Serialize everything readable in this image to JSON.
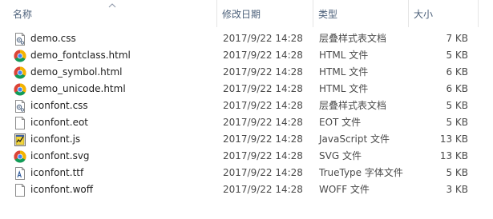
{
  "columns": {
    "name": "名称",
    "date": "修改日期",
    "type": "类型",
    "size": "大小"
  },
  "files": [
    {
      "name": "demo.css",
      "date": "2017/9/22 14:28",
      "type": "层叠样式表文档",
      "size": "7 KB",
      "icon": "css-file-icon"
    },
    {
      "name": "demo_fontclass.html",
      "date": "2017/9/22 14:28",
      "type": "HTML 文件",
      "size": "5 KB",
      "icon": "chrome-icon"
    },
    {
      "name": "demo_symbol.html",
      "date": "2017/9/22 14:28",
      "type": "HTML 文件",
      "size": "6 KB",
      "icon": "chrome-icon"
    },
    {
      "name": "demo_unicode.html",
      "date": "2017/9/22 14:28",
      "type": "HTML 文件",
      "size": "6 KB",
      "icon": "chrome-icon"
    },
    {
      "name": "iconfont.css",
      "date": "2017/9/22 14:28",
      "type": "层叠样式表文档",
      "size": "5 KB",
      "icon": "css-file-icon"
    },
    {
      "name": "iconfont.eot",
      "date": "2017/9/22 14:28",
      "type": "EOT 文件",
      "size": "5 KB",
      "icon": "blank-file-icon"
    },
    {
      "name": "iconfont.js",
      "date": "2017/9/22 14:28",
      "type": "JavaScript 文件",
      "size": "13 KB",
      "icon": "js-file-icon"
    },
    {
      "name": "iconfont.svg",
      "date": "2017/9/22 14:28",
      "type": "SVG 文件",
      "size": "13 KB",
      "icon": "chrome-icon"
    },
    {
      "name": "iconfont.ttf",
      "date": "2017/9/22 14:28",
      "type": "TrueType 字体文件",
      "size": "5 KB",
      "icon": "font-file-icon"
    },
    {
      "name": "iconfont.woff",
      "date": "2017/9/22 14:28",
      "type": "WOFF 文件",
      "size": "3 KB",
      "icon": "blank-file-icon"
    }
  ],
  "colors": {
    "header_text": "#4c607a",
    "separator": "#e5e5e5"
  }
}
